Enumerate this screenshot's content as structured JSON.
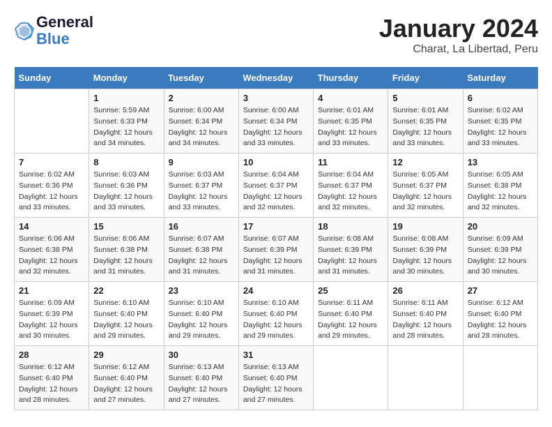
{
  "header": {
    "logo_line1": "General",
    "logo_line2": "Blue",
    "title": "January 2024",
    "subtitle": "Charat, La Libertad, Peru"
  },
  "columns": [
    "Sunday",
    "Monday",
    "Tuesday",
    "Wednesday",
    "Thursday",
    "Friday",
    "Saturday"
  ],
  "weeks": [
    [
      {
        "day": "",
        "info": ""
      },
      {
        "day": "1",
        "info": "Sunrise: 5:59 AM\nSunset: 6:33 PM\nDaylight: 12 hours\nand 34 minutes."
      },
      {
        "day": "2",
        "info": "Sunrise: 6:00 AM\nSunset: 6:34 PM\nDaylight: 12 hours\nand 34 minutes."
      },
      {
        "day": "3",
        "info": "Sunrise: 6:00 AM\nSunset: 6:34 PM\nDaylight: 12 hours\nand 33 minutes."
      },
      {
        "day": "4",
        "info": "Sunrise: 6:01 AM\nSunset: 6:35 PM\nDaylight: 12 hours\nand 33 minutes."
      },
      {
        "day": "5",
        "info": "Sunrise: 6:01 AM\nSunset: 6:35 PM\nDaylight: 12 hours\nand 33 minutes."
      },
      {
        "day": "6",
        "info": "Sunrise: 6:02 AM\nSunset: 6:35 PM\nDaylight: 12 hours\nand 33 minutes."
      }
    ],
    [
      {
        "day": "7",
        "info": "Sunrise: 6:02 AM\nSunset: 6:36 PM\nDaylight: 12 hours\nand 33 minutes."
      },
      {
        "day": "8",
        "info": "Sunrise: 6:03 AM\nSunset: 6:36 PM\nDaylight: 12 hours\nand 33 minutes."
      },
      {
        "day": "9",
        "info": "Sunrise: 6:03 AM\nSunset: 6:37 PM\nDaylight: 12 hours\nand 33 minutes."
      },
      {
        "day": "10",
        "info": "Sunrise: 6:04 AM\nSunset: 6:37 PM\nDaylight: 12 hours\nand 32 minutes."
      },
      {
        "day": "11",
        "info": "Sunrise: 6:04 AM\nSunset: 6:37 PM\nDaylight: 12 hours\nand 32 minutes."
      },
      {
        "day": "12",
        "info": "Sunrise: 6:05 AM\nSunset: 6:37 PM\nDaylight: 12 hours\nand 32 minutes."
      },
      {
        "day": "13",
        "info": "Sunrise: 6:05 AM\nSunset: 6:38 PM\nDaylight: 12 hours\nand 32 minutes."
      }
    ],
    [
      {
        "day": "14",
        "info": "Sunrise: 6:06 AM\nSunset: 6:38 PM\nDaylight: 12 hours\nand 32 minutes."
      },
      {
        "day": "15",
        "info": "Sunrise: 6:06 AM\nSunset: 6:38 PM\nDaylight: 12 hours\nand 31 minutes."
      },
      {
        "day": "16",
        "info": "Sunrise: 6:07 AM\nSunset: 6:38 PM\nDaylight: 12 hours\nand 31 minutes."
      },
      {
        "day": "17",
        "info": "Sunrise: 6:07 AM\nSunset: 6:39 PM\nDaylight: 12 hours\nand 31 minutes."
      },
      {
        "day": "18",
        "info": "Sunrise: 6:08 AM\nSunset: 6:39 PM\nDaylight: 12 hours\nand 31 minutes."
      },
      {
        "day": "19",
        "info": "Sunrise: 6:08 AM\nSunset: 6:39 PM\nDaylight: 12 hours\nand 30 minutes."
      },
      {
        "day": "20",
        "info": "Sunrise: 6:09 AM\nSunset: 6:39 PM\nDaylight: 12 hours\nand 30 minutes."
      }
    ],
    [
      {
        "day": "21",
        "info": "Sunrise: 6:09 AM\nSunset: 6:39 PM\nDaylight: 12 hours\nand 30 minutes."
      },
      {
        "day": "22",
        "info": "Sunrise: 6:10 AM\nSunset: 6:40 PM\nDaylight: 12 hours\nand 29 minutes."
      },
      {
        "day": "23",
        "info": "Sunrise: 6:10 AM\nSunset: 6:40 PM\nDaylight: 12 hours\nand 29 minutes."
      },
      {
        "day": "24",
        "info": "Sunrise: 6:10 AM\nSunset: 6:40 PM\nDaylight: 12 hours\nand 29 minutes."
      },
      {
        "day": "25",
        "info": "Sunrise: 6:11 AM\nSunset: 6:40 PM\nDaylight: 12 hours\nand 29 minutes."
      },
      {
        "day": "26",
        "info": "Sunrise: 6:11 AM\nSunset: 6:40 PM\nDaylight: 12 hours\nand 28 minutes."
      },
      {
        "day": "27",
        "info": "Sunrise: 6:12 AM\nSunset: 6:40 PM\nDaylight: 12 hours\nand 28 minutes."
      }
    ],
    [
      {
        "day": "28",
        "info": "Sunrise: 6:12 AM\nSunset: 6:40 PM\nDaylight: 12 hours\nand 28 minutes."
      },
      {
        "day": "29",
        "info": "Sunrise: 6:12 AM\nSunset: 6:40 PM\nDaylight: 12 hours\nand 27 minutes."
      },
      {
        "day": "30",
        "info": "Sunrise: 6:13 AM\nSunset: 6:40 PM\nDaylight: 12 hours\nand 27 minutes."
      },
      {
        "day": "31",
        "info": "Sunrise: 6:13 AM\nSunset: 6:40 PM\nDaylight: 12 hours\nand 27 minutes."
      },
      {
        "day": "",
        "info": ""
      },
      {
        "day": "",
        "info": ""
      },
      {
        "day": "",
        "info": ""
      }
    ]
  ]
}
